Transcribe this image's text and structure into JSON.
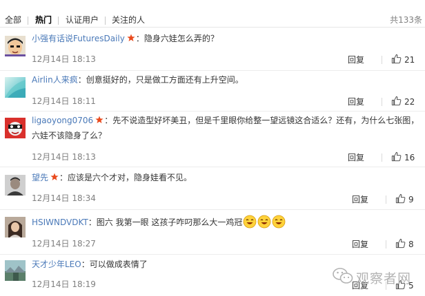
{
  "tabs": {
    "all": "全部",
    "hot": "热门",
    "verified": "认证用户",
    "following": "关注的人",
    "total": "共133条"
  },
  "colors": {
    "username": "#4a79b8",
    "vip_badge": "#e94a1d",
    "meta_gray": "#808080"
  },
  "comments": [
    {
      "user": "小强有话说FuturesDaily",
      "vip": true,
      "text": "隐身六娃怎么弄的？",
      "date": "12月14日 18:13",
      "reply": "回复",
      "likes": "21",
      "avatar_icon": "cartoon-avatar-icon"
    },
    {
      "user": "Airlin人来疯",
      "vip": false,
      "text": "创意挺好的，只是做工方面还有上升空间。",
      "date": "12月14日 18:11",
      "reply": "回复",
      "likes": "22",
      "avatar_icon": "cyan-abstract-avatar-icon"
    },
    {
      "user": "ligaoyong0706",
      "vip": true,
      "text": "先不说造型好坏美丑，但是千里眼你给整一望远镜这合适么？还有，为什么七张图，六娃不该隐身了么？",
      "date": "12月14日 18:13",
      "reply": "回复",
      "likes": "16",
      "avatar_icon": "red-cartoon-avatar-icon"
    },
    {
      "user": "望先",
      "vip": true,
      "text": "应该是六个才对，隐身娃看不见。",
      "date": "12月14日 18:34",
      "reply": "回复",
      "likes": "9",
      "avatar_icon": "person-photo-avatar-icon"
    },
    {
      "user": "HSIWNDVDKT",
      "vip": false,
      "text": "图六 我第一眼 这孩子咋叼那么大一鸡冠",
      "emojis": [
        "laugh-emoji-icon",
        "laugh-emoji-icon",
        "laugh-emoji-icon"
      ],
      "date": "12月14日 18:27",
      "reply": "回复",
      "likes": "8",
      "avatar_icon": "girl-photo-avatar-icon"
    },
    {
      "user": "天才少年LEO",
      "vip": false,
      "text": "可以做成表情了",
      "date": "12月14日 18:19",
      "reply": "回复",
      "likes": "5",
      "avatar_icon": "landscape-avatar-icon"
    }
  ],
  "watermark": {
    "text": "观察者网",
    "icon": "wechat-icon"
  }
}
